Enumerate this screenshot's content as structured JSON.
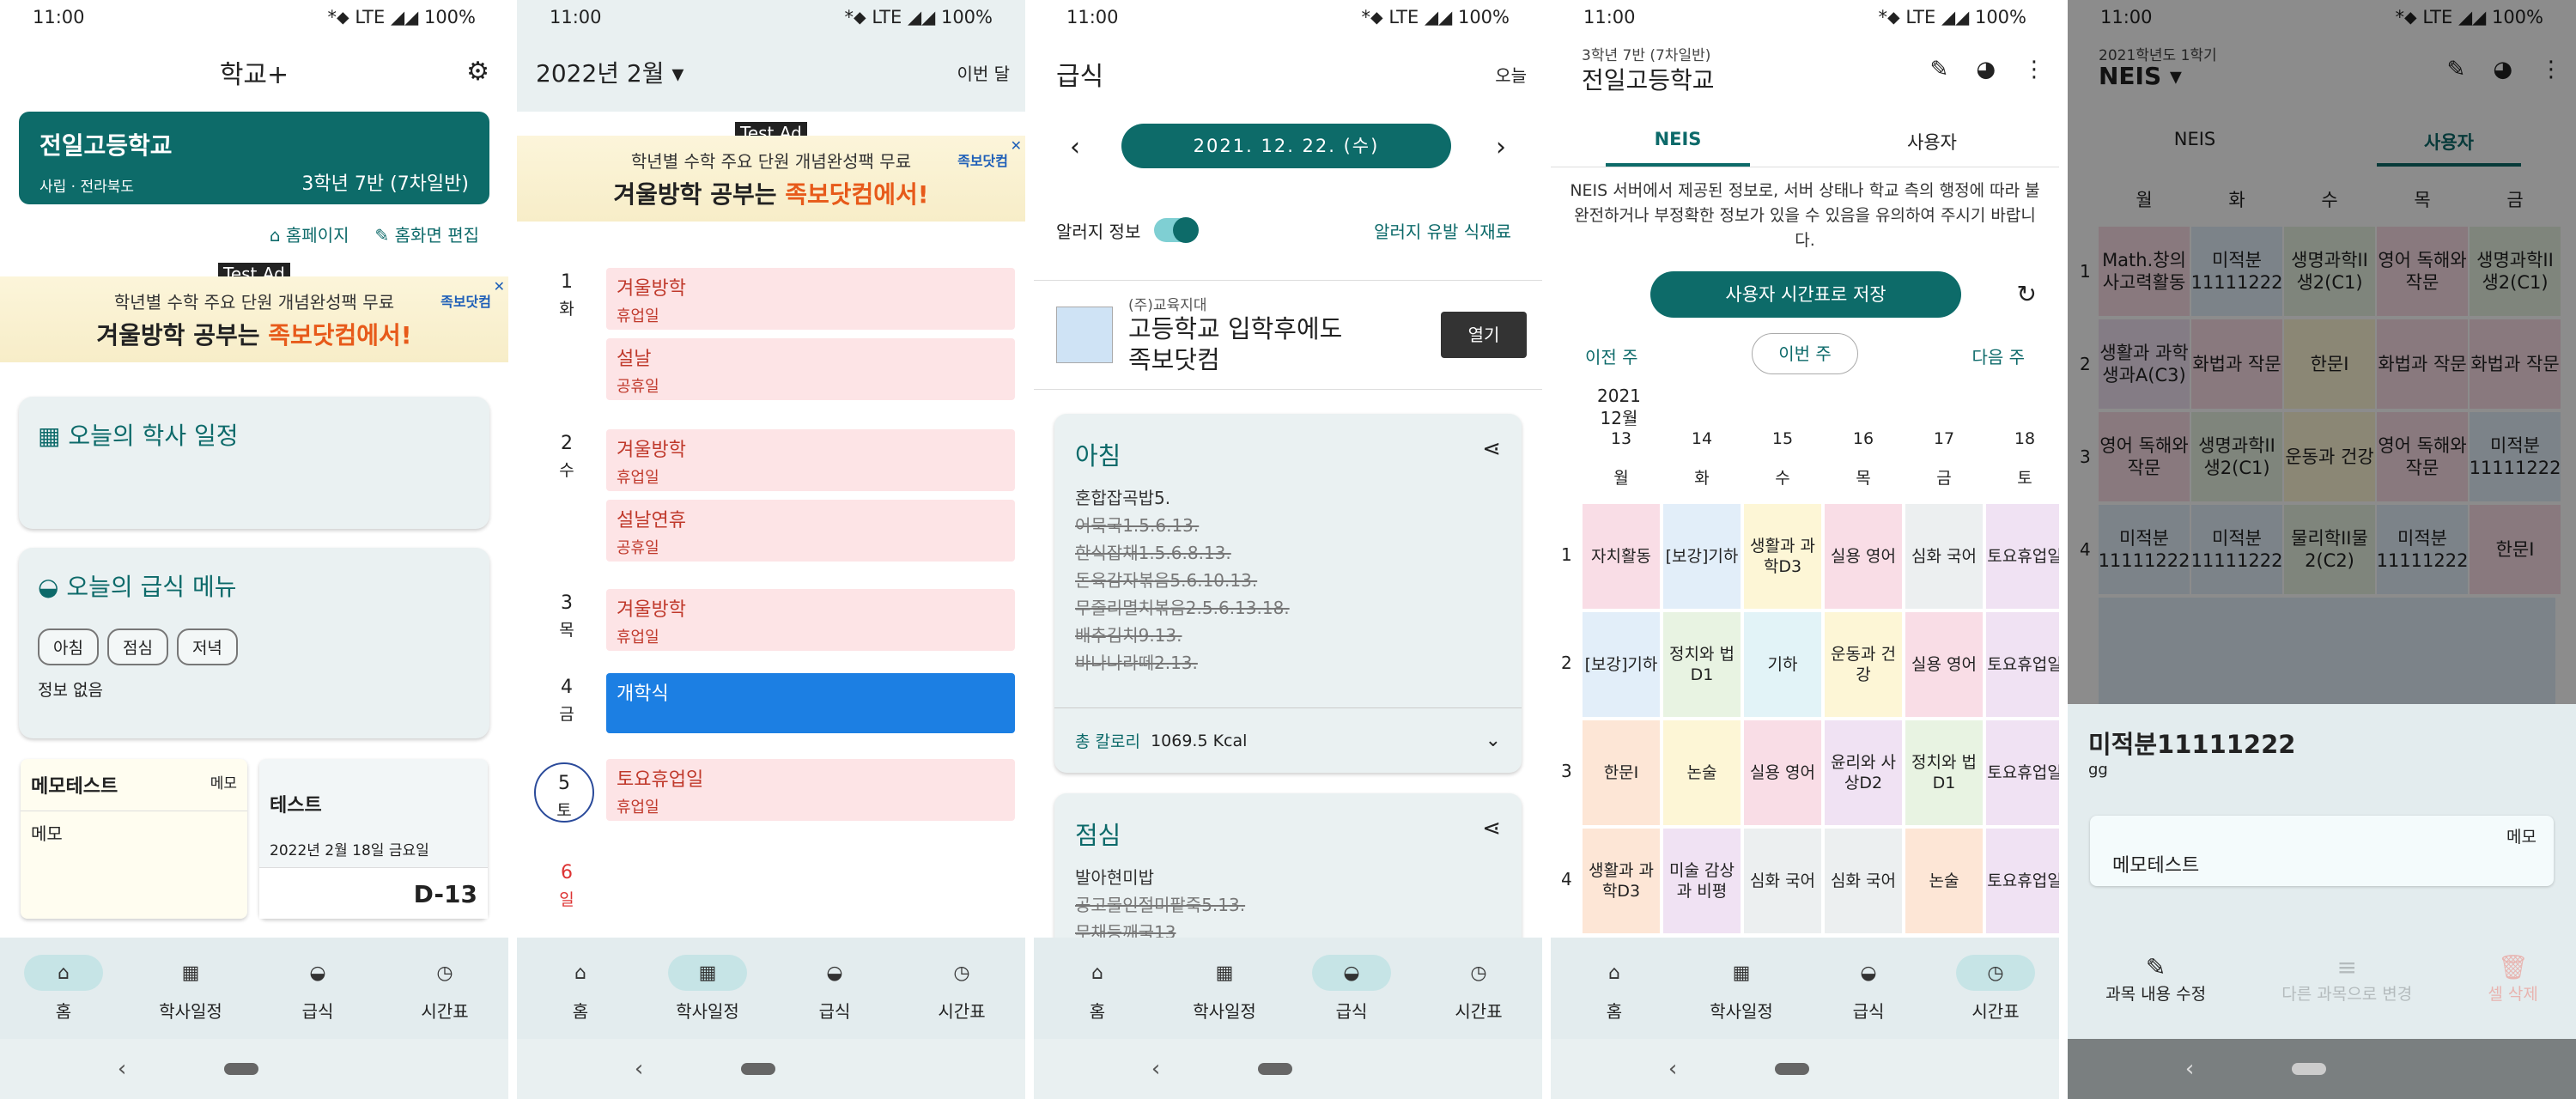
{
  "status": {
    "time": "11:00",
    "icons": "*⬥ LTE ◢◢",
    "battery": "100%"
  },
  "nav_tabs": [
    "홈",
    "학사일정",
    "급식",
    "시간표"
  ],
  "p1": {
    "title": "학교+",
    "school": "전일고등학교",
    "sub": "사립 · 전라북도",
    "class": "3학년 7반 (7차일반)",
    "homepage": "홈페이지",
    "edit_home": "홈화면 편집",
    "schedule_title": "오늘의 학사 일정",
    "meal_title": "오늘의 급식 메뉴",
    "meal_chips": [
      "아침",
      "점심",
      "저녁"
    ],
    "meal_info": "정보 없음",
    "memo_title": "메모테스트",
    "memo_tag": "메모",
    "memo_body": "메모",
    "dday_title": "테스트",
    "dday_date": "2022년 2월 18일 금요일",
    "dday": "D-13"
  },
  "ad": {
    "test": "Test Ad",
    "line1": "학년별 수학 주요 단원 개념완성팩 무료",
    "line2a": "겨울방학 공부는 ",
    "line2b": "족보닷컴에서!",
    "brand": "족보닷컴"
  },
  "p2": {
    "month": "2022년 2월",
    "this_month": "이번 달",
    "days": [
      {
        "n": "1",
        "w": "화",
        "events": [
          {
            "t": "겨울방학",
            "s": "휴업일"
          },
          {
            "t": "설날",
            "s": "공휴일"
          }
        ]
      },
      {
        "n": "2",
        "w": "수",
        "events": [
          {
            "t": "겨울방학",
            "s": "휴업일"
          },
          {
            "t": "설날연휴",
            "s": "공휴일"
          }
        ]
      },
      {
        "n": "3",
        "w": "목",
        "events": [
          {
            "t": "겨울방학",
            "s": "휴업일"
          }
        ]
      },
      {
        "n": "4",
        "w": "금",
        "events": [
          {
            "t": "개학식",
            "s": ""
          }
        ]
      },
      {
        "n": "5",
        "w": "토",
        "events": [
          {
            "t": "토요휴업일",
            "s": "휴업일"
          }
        ]
      },
      {
        "n": "6",
        "w": "일",
        "events": []
      }
    ]
  },
  "p3": {
    "title": "급식",
    "today": "오늘",
    "date": "2021. 12. 22. (수)",
    "allergy": "알러지 정보",
    "allergy_link": "알러지 유발 식재료",
    "ad_company": "(주)교육지대",
    "ad_title": "고등학교 입학후에도",
    "ad_title2": "족보닷컴",
    "ad_open": "열기",
    "breakfast": {
      "title": "아침",
      "items": [
        "혼합잡곡밥5.",
        "어묵국1.5.6.13.",
        "한식잡채1.5.6.8.13.",
        "돈육감자볶음5.6.10.13.",
        "무줄리멸치볶음2.5.6.13.18.",
        "배추김치9.13.",
        "바나나라떼2.13."
      ],
      "cal_label": "총 칼로리",
      "cal": "1069.5 Kcal"
    },
    "lunch": {
      "title": "점심",
      "items": [
        "발아현미밥",
        "공고물인절미팥죽5.13.",
        "무채등깨국13"
      ]
    }
  },
  "p4": {
    "sub": "3학년 7반 (7차일반)",
    "school": "전일고등학교",
    "tab_neis": "NEIS",
    "tab_user": "사용자",
    "notice": "NEIS 서버에서 제공된 정보로, 서버 상태나 학교 측의 행정에 따라 불완전하거나 부정확한 정보가 있을 수 있음을 유의하여 주시기 바랍니다.",
    "save": "사용자 시간표로 저장",
    "prev": "이전 주",
    "this": "이번 주",
    "next": "다음 주",
    "year": "2021",
    "month": "12월",
    "dates": [
      "13",
      "14",
      "15",
      "16",
      "17",
      "18"
    ],
    "weekdays": [
      "월",
      "화",
      "수",
      "목",
      "금",
      "토"
    ],
    "rows": [
      [
        "자치활동",
        "[보강]기하",
        "생활과 과학D3",
        "실용 영어",
        "심화 국어",
        "토요휴업일"
      ],
      [
        "[보강]기하",
        "정치와 법D1",
        "기하",
        "운동과 건강",
        "실용 영어",
        "토요휴업일"
      ],
      [
        "한문I",
        "논술",
        "실용 영어",
        "윤리와 사상D2",
        "정치와 법D1",
        "토요휴업일"
      ],
      [
        "생활과 과학D3",
        "미술 감상과 비평",
        "심화 국어",
        "심화 국어",
        "논술",
        "토요휴업일"
      ]
    ]
  },
  "p5": {
    "sub": "2021학년도 1학기",
    "title": "NEIS",
    "tab_neis": "NEIS",
    "tab_user": "사용자",
    "weekdays": [
      "월",
      "화",
      "수",
      "목",
      "금"
    ],
    "rows": [
      [
        "Math.창의사고력활동",
        "미적분11111222",
        "생명과학II생2(C1)",
        "영어 독해와작문",
        "생명과학II생2(C1)"
      ],
      [
        "생활과 과학생과A(C3)",
        "화법과 작문",
        "한문I",
        "화법과 작문",
        "화법과 작문"
      ],
      [
        "영어 독해와작문",
        "생명과학II생2(C1)",
        "운동과 건강",
        "영어 독해와작문",
        "미적분11111222"
      ],
      [
        "미적분11111222",
        "미적분11111222",
        "물리학II물2(C2)",
        "미적분11111222",
        "한문I"
      ]
    ],
    "sheet_title": "미적분11111222",
    "sheet_sub": "gg",
    "memo_tag": "메모",
    "memo_body": "메모테스트",
    "act_edit": "과목 내용 수정",
    "act_change": "다른 과목으로 변경",
    "act_delete": "셀 삭제"
  }
}
